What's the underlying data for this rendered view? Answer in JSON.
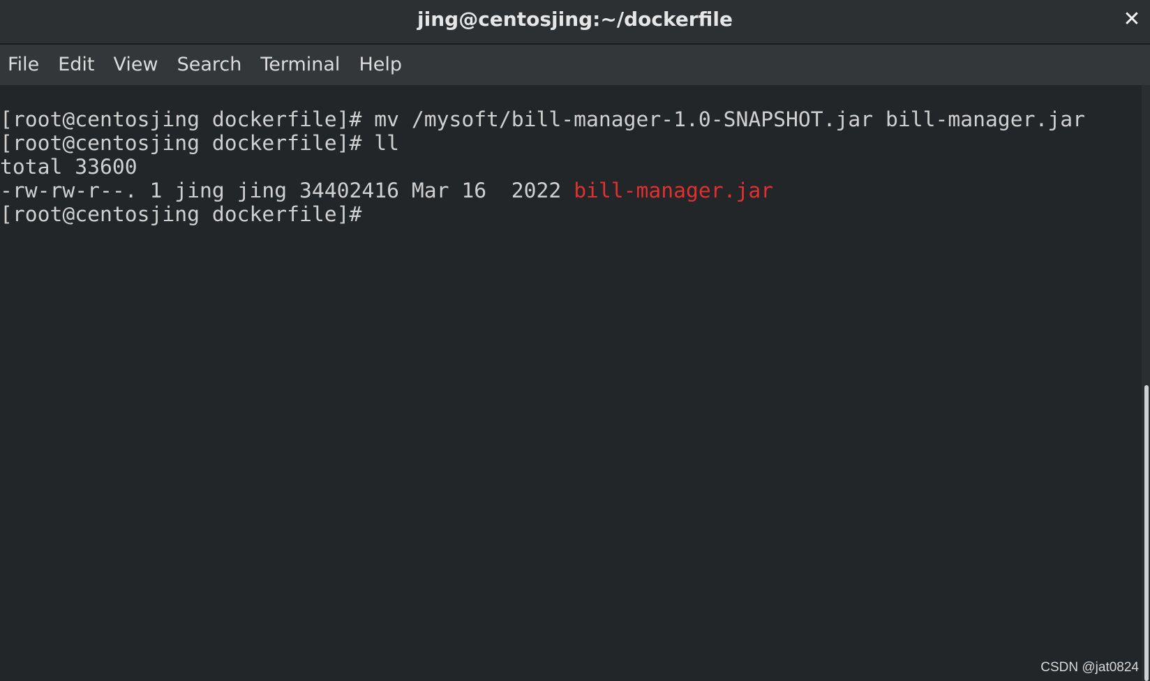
{
  "window": {
    "title": "jing@centosjing:~/dockerfile",
    "close_glyph": "✕"
  },
  "menu": {
    "items": [
      "File",
      "Edit",
      "View",
      "Search",
      "Terminal",
      "Help"
    ]
  },
  "terminal": {
    "lines": [
      {
        "prompt": "[root@centosjing dockerfile]#",
        "command": " mv /mysoft/bill-manager-1.0-SNAPSHOT.jar bill-manager.jar"
      },
      {
        "prompt": "[root@centosjing dockerfile]#",
        "command": " ll"
      },
      {
        "output": "total 33600"
      },
      {
        "output": "-rw-rw-r--. 1 jing jing 34402416 Mar 16  2022 ",
        "filename": "bill-manager.jar",
        "filename_color": "#e03030"
      },
      {
        "prompt": "[root@centosjing dockerfile]#",
        "command": ""
      }
    ]
  },
  "watermark": "CSDN @jat0824",
  "colors": {
    "background": "#232629",
    "titlebar": "#2c3033",
    "menubar": "#33373a",
    "text": "#d0d0d0",
    "highlight_file": "#e03030"
  }
}
